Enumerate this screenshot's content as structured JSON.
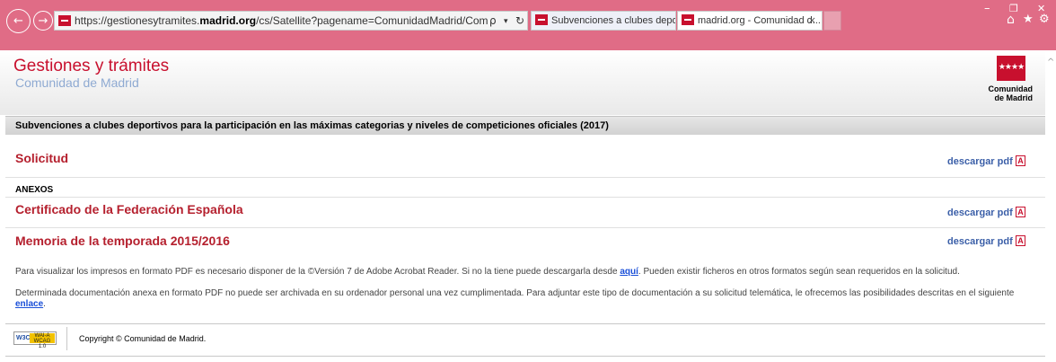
{
  "browser": {
    "url_prefix": "https://gestionesytramites.",
    "url_domain": "madrid.org",
    "url_suffix": "/cs/Satellite?pagename=ComunidadMadrid/Comunes/Presentacion",
    "search_icon": "ρ",
    "dropdown_icon": "▾",
    "refresh_icon": "↻",
    "back_icon": "←",
    "forward_icon": "→",
    "tabs": [
      {
        "label": "Subvenciones a clubes deporti..."
      },
      {
        "label": "madrid.org - Comunidad d...",
        "close": "×"
      }
    ],
    "window": {
      "minimize": "–",
      "restore": "❐",
      "close": "✕"
    },
    "toolbar": {
      "home": "⌂",
      "favorites": "★",
      "settings": "⚙"
    }
  },
  "header": {
    "title": "Gestiones y trámites",
    "subtitle": "Comunidad de Madrid",
    "logo_line1": "Comunidad",
    "logo_line2": "de Madrid",
    "logo_stars": "★★★★"
  },
  "page_heading": "Subvenciones a clubes deportivos para la participación en las máximas categorias y niveles de competiciones oficiales (2017)",
  "documents": [
    {
      "title": "Solicitud",
      "link": "descargar pdf"
    },
    {
      "title": "Certificado de la Federación Española",
      "link": "descargar pdf"
    },
    {
      "title": "Memoria de la temporada 2015/2016",
      "link": "descargar pdf"
    }
  ],
  "annexes_label": "ANEXOS",
  "notes": {
    "note1_before": "Para visualizar los impresos en formato PDF es necesario disponer de la ©Versión 7 de Adobe Acrobat Reader. Si no la tiene puede descargarla desde ",
    "note1_link": "aquí",
    "note1_after": ". Pueden existir ficheros en otros formatos según sean requeridos en la solicitud.",
    "note2_before": "Determinada documentación anexa en formato PDF no puede ser archivada en su ordenador personal una vez cumplimentada. Para adjuntar este tipo de documentación a su solicitud telemática, le ofrecemos las posibilidades descritas en el siguiente ",
    "note2_link": "enlace",
    "note2_after": "."
  },
  "footer": {
    "w3c": "W3C",
    "wai_line1": "WAI-A",
    "wai_line2": "WCAG 1.0",
    "copyright": "Copyright © Comunidad de Madrid."
  },
  "colors": {
    "chrome": "#e06c86",
    "brand_red": "#c8102e",
    "link_blue": "#3b5fa8"
  }
}
